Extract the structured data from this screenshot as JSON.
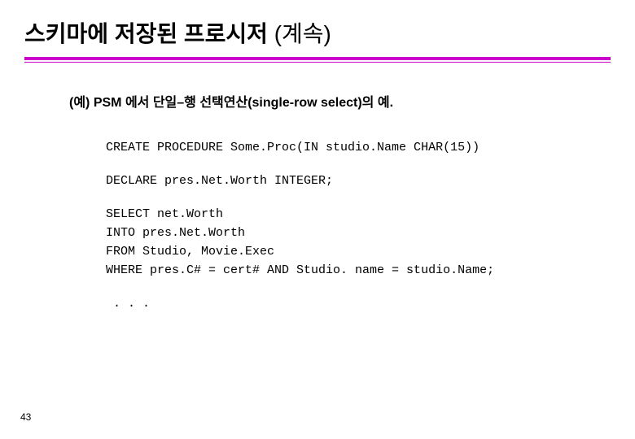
{
  "title_main": "스키마에 저장된 프로시저",
  "title_sub": " (계속)",
  "subtitle": "(예) PSM 에서 단일–행 선택연산(single-row select)의 예.",
  "code": {
    "line1": "CREATE PROCEDURE Some.Proc(IN studio.Name CHAR(15))",
    "line2": "DECLARE pres.Net.Worth INTEGER;",
    "line3": "SELECT net.Worth",
    "line4": "INTO pres.Net.Worth",
    "line5": "FROM Studio, Movie.Exec",
    "line6": "WHERE pres.C# = cert# AND Studio. name = studio.Name;",
    "line7": " . . ."
  },
  "page_number": "43"
}
